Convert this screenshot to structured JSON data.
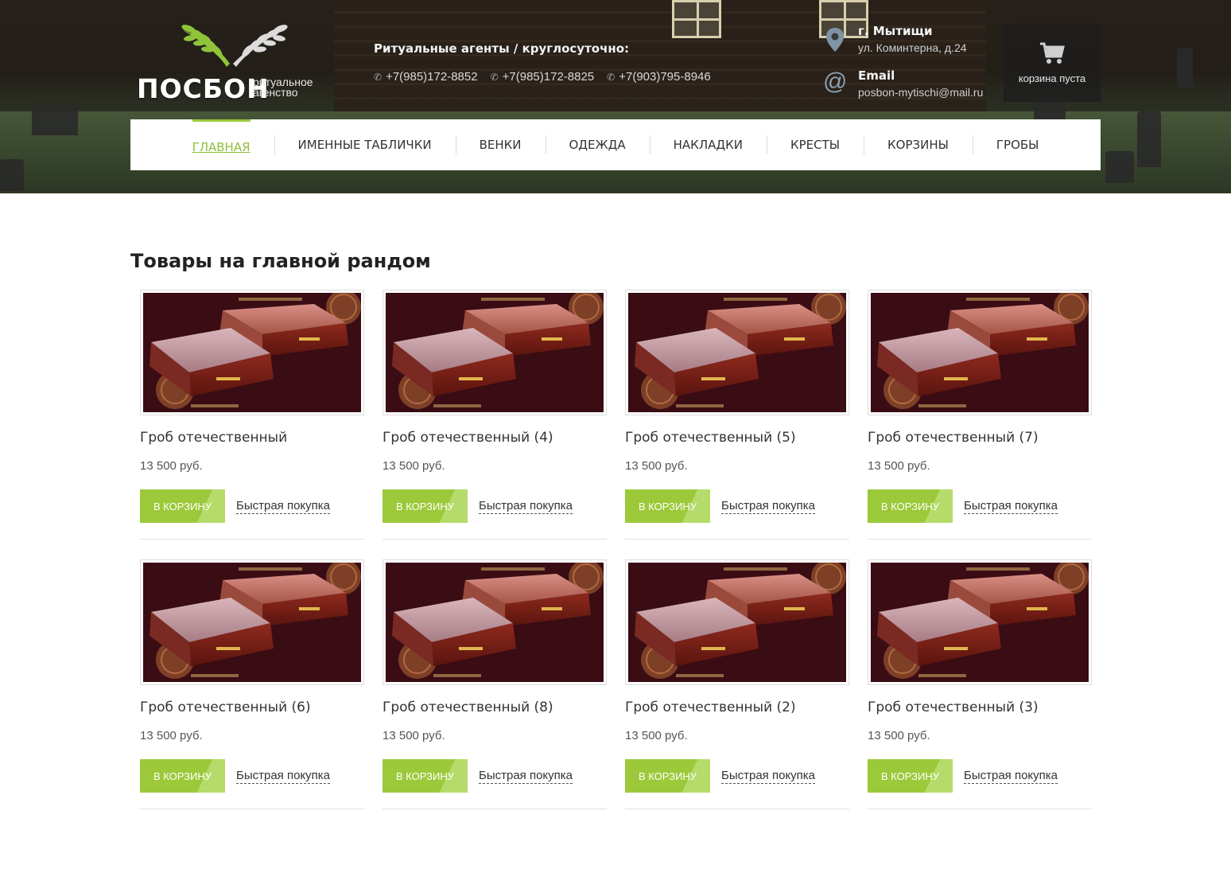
{
  "header": {
    "logo": {
      "name": "ПОСБОН",
      "subtitle": "ритуальное агенство"
    },
    "phones": {
      "title": "Ритуальные агенты / круглосуточно:",
      "numbers": [
        "+7(985)172-8852",
        "+7(985)172-8825",
        "+7(903)795-8946"
      ]
    },
    "address": {
      "city": "г. Мытищи",
      "street": "ул. Коминтерна, д.24"
    },
    "email": {
      "label": "Email",
      "value": "posbon-mytischi@mail.ru"
    },
    "cart": {
      "label": "корзина пуста"
    }
  },
  "nav": {
    "items": [
      {
        "label": "Главная"
      },
      {
        "label": "Именные таблички"
      },
      {
        "label": "Венки"
      },
      {
        "label": "Одежда"
      },
      {
        "label": "Накладки"
      },
      {
        "label": "Кресты"
      },
      {
        "label": "Корзины"
      },
      {
        "label": "Гробы"
      }
    ]
  },
  "main": {
    "title": "Товары на главной рандом",
    "products": [
      {
        "name": "Гроб отечественный",
        "price": "13 500 руб.",
        "add_label": "В корзину",
        "quick_label": "Быстрая покупка"
      },
      {
        "name": "Гроб отечественный (4)",
        "price": "13 500 руб.",
        "add_label": "В корзину",
        "quick_label": "Быстрая покупка"
      },
      {
        "name": "Гроб отечественный (5)",
        "price": "13 500 руб.",
        "add_label": "В корзину",
        "quick_label": "Быстрая покупка"
      },
      {
        "name": "Гроб отечественный (7)",
        "price": "13 500 руб.",
        "add_label": "В корзину",
        "quick_label": "Быстрая покупка"
      },
      {
        "name": "Гроб отечественный (6)",
        "price": "13 500 руб.",
        "add_label": "В корзину",
        "quick_label": "Быстрая покупка"
      },
      {
        "name": "Гроб отечественный (8)",
        "price": "13 500 руб.",
        "add_label": "В корзину",
        "quick_label": "Быстрая покупка"
      },
      {
        "name": "Гроб отечественный (2)",
        "price": "13 500 руб.",
        "add_label": "В корзину",
        "quick_label": "Быстрая покупка"
      },
      {
        "name": "Гроб отечественный (3)",
        "price": "13 500 руб.",
        "add_label": "В корзину",
        "quick_label": "Быстрая покупка"
      }
    ]
  },
  "colors": {
    "accent": "#9cc93a",
    "nav_active": "#8fbf3a",
    "image_bg": "#3a0c14"
  }
}
